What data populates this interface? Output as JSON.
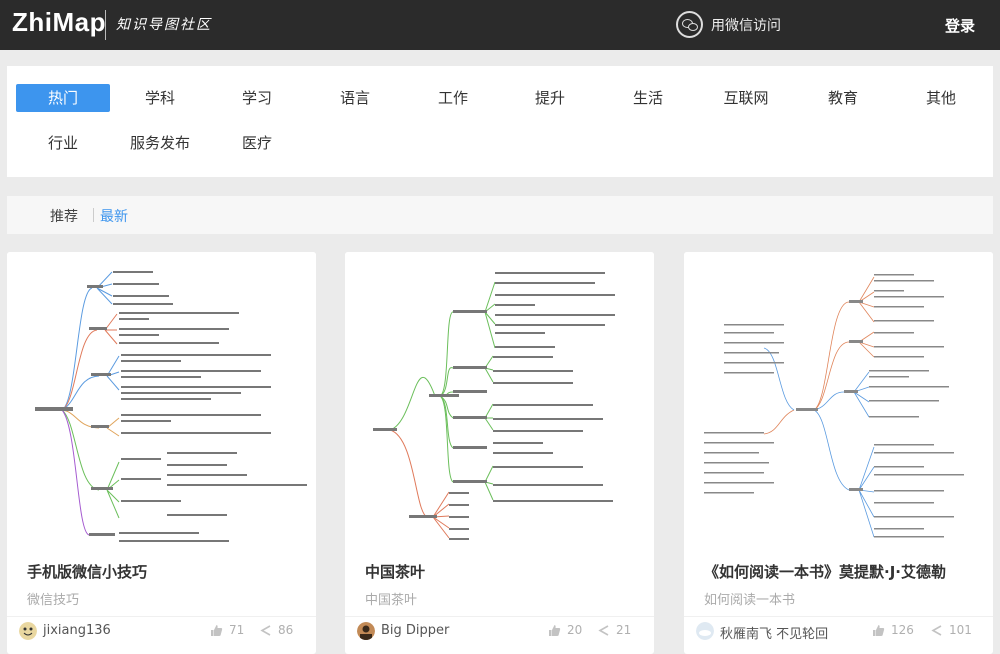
{
  "header": {
    "logo": "ZhiMap",
    "tagline": "知识导图社区",
    "wechat_login": "用微信访问",
    "login": "登录"
  },
  "categories": [
    "热门",
    "学科",
    "学习",
    "语言",
    "工作",
    "提升",
    "生活",
    "互联网",
    "教育",
    "其他",
    "行业",
    "服务发布",
    "医疗"
  ],
  "active_category": "热门",
  "sort": {
    "recommend": "推荐",
    "latest": "最新"
  },
  "cards": [
    {
      "title": "手机版微信小技巧",
      "subtitle": "微信技巧",
      "author": "jixiang136",
      "likes": "71",
      "shares": "86"
    },
    {
      "title": "中国茶叶",
      "subtitle": "中国茶叶",
      "author": "Big Dipper",
      "likes": "20",
      "shares": "21"
    },
    {
      "title": "《如何阅读一本书》莫提默·J·艾德勒",
      "subtitle": "如何阅读一本书",
      "author": "秋雁南飞 不见轮回",
      "likes": "126",
      "shares": "101"
    }
  ],
  "colors": {
    "header_bg": "#2b2b2b",
    "accent": "#3d95ee",
    "page_bg": "#ebebeb"
  }
}
